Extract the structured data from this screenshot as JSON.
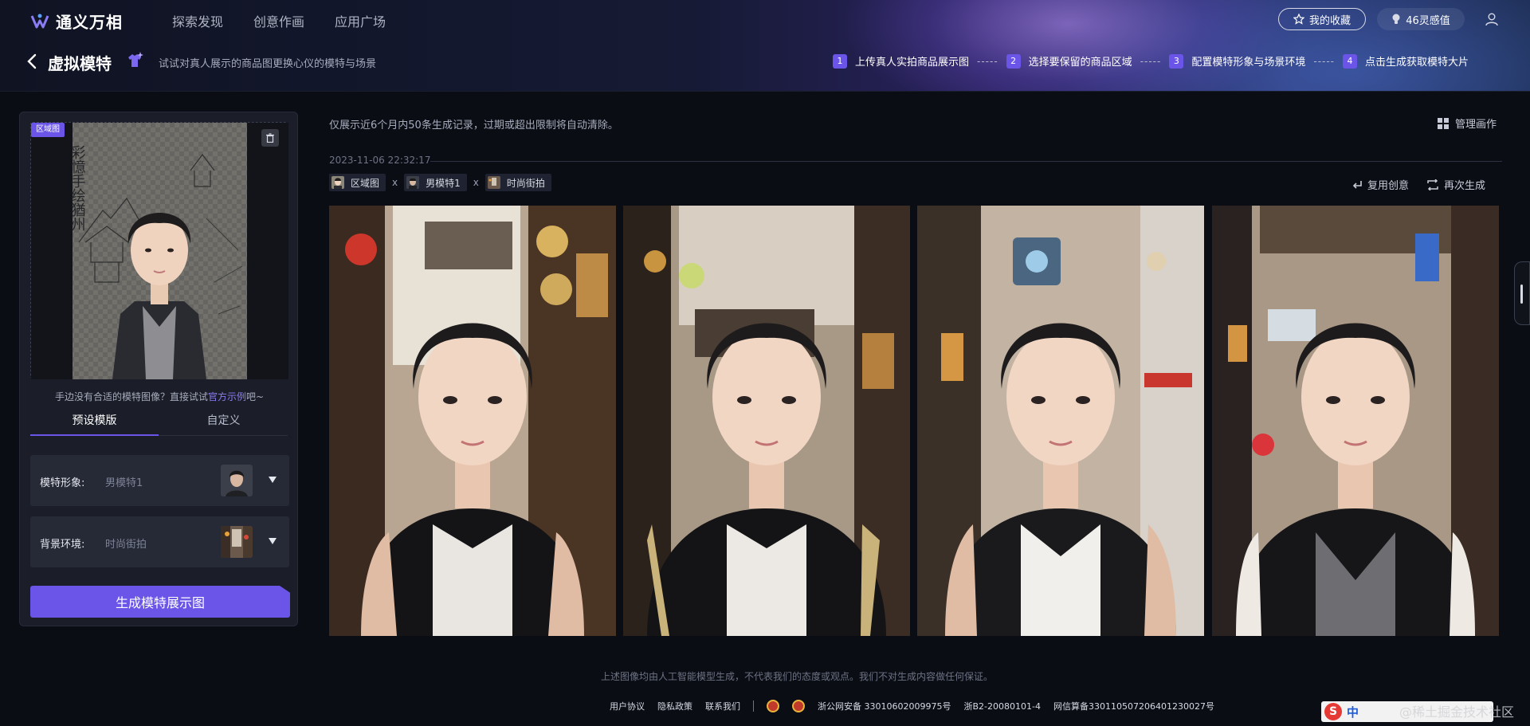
{
  "app": {
    "name": "通义万相"
  },
  "nav": [
    "探索发现",
    "创意作画",
    "应用广场"
  ],
  "header": {
    "favorites_label": "我的收藏",
    "points_label": "46灵感值"
  },
  "page": {
    "title": "虚拟模特",
    "description": "试试对真人展示的商品图更换心仪的模特与场景"
  },
  "steps": [
    {
      "num": "1",
      "label": "上传真人实拍商品展示图"
    },
    {
      "num": "2",
      "label": "选择要保留的商品区域"
    },
    {
      "num": "3",
      "label": "配置模特形象与场景环境"
    },
    {
      "num": "4",
      "label": "点击生成获取模特大片"
    }
  ],
  "step_separator": "-----",
  "left_panel": {
    "region_tag": "区域图",
    "calligraphy": "彩憶手绘猶州",
    "hint_prefix": "手边没有合适的模特图像？直接试试",
    "hint_link": "官方示例",
    "hint_suffix": "吧~",
    "tabs": {
      "preset": "预设模版",
      "custom": "自定义"
    },
    "model": {
      "label": "模特形象:",
      "value": "男模特1"
    },
    "background": {
      "label": "背景环境:",
      "value": "时尚街拍"
    },
    "generate_button": "生成模特展示图"
  },
  "main": {
    "notice": "仅展示近6个月内50条生成记录，过期或超出限制将自动清除。",
    "manage_label": "管理画作",
    "timestamp": "2023-11-06 22:32:17",
    "chips": [
      "区域图",
      "男模特1",
      "时尚街拍"
    ],
    "chip_separator": "x",
    "reuse_label": "复用创意",
    "regenerate_label": "再次生成"
  },
  "footer": {
    "disclaimer": "上述图像均由人工智能模型生成，不代表我们的态度或观点。我们不对生成内容做任何保证。",
    "links": [
      "用户协议",
      "隐私政策",
      "联系我们"
    ],
    "police_record": "浙公网安备 33010602009975号",
    "icp": "浙B2-20080101-4",
    "algo_record": "网信算备330110507206401230027号"
  },
  "ime": {
    "lang": "中",
    "watermark": "@稀土掘金技术社区"
  },
  "colors": {
    "accent": "#6a55e8",
    "background": "#0a0d14",
    "panel": "#1b1e29"
  }
}
